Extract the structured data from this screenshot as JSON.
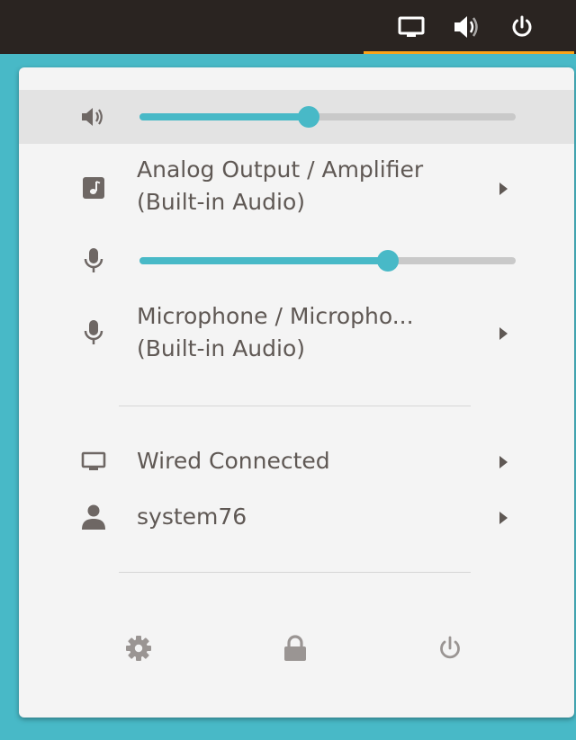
{
  "topbar": {
    "icons": [
      "display-icon",
      "volume-icon",
      "power-icon"
    ]
  },
  "popup": {
    "output": {
      "volume_level_percent": 45,
      "device_line1": "Analog Output / Amplifier",
      "device_line2": "(Built-in Audio)"
    },
    "input": {
      "volume_level_percent": 66,
      "device_line1": "Microphone / Micropho...",
      "device_line2": "(Built-in Audio)"
    },
    "network_label": "Wired Connected",
    "user_label": "system76",
    "footer_icons": [
      "settings-icon",
      "lock-icon",
      "power-icon"
    ]
  },
  "colors": {
    "accent": "#48b9c7",
    "topbar": "#2a2421",
    "highlight_underline": "#faa41a",
    "popup_bg": "#f4f4f4",
    "text": "#5f5854"
  }
}
